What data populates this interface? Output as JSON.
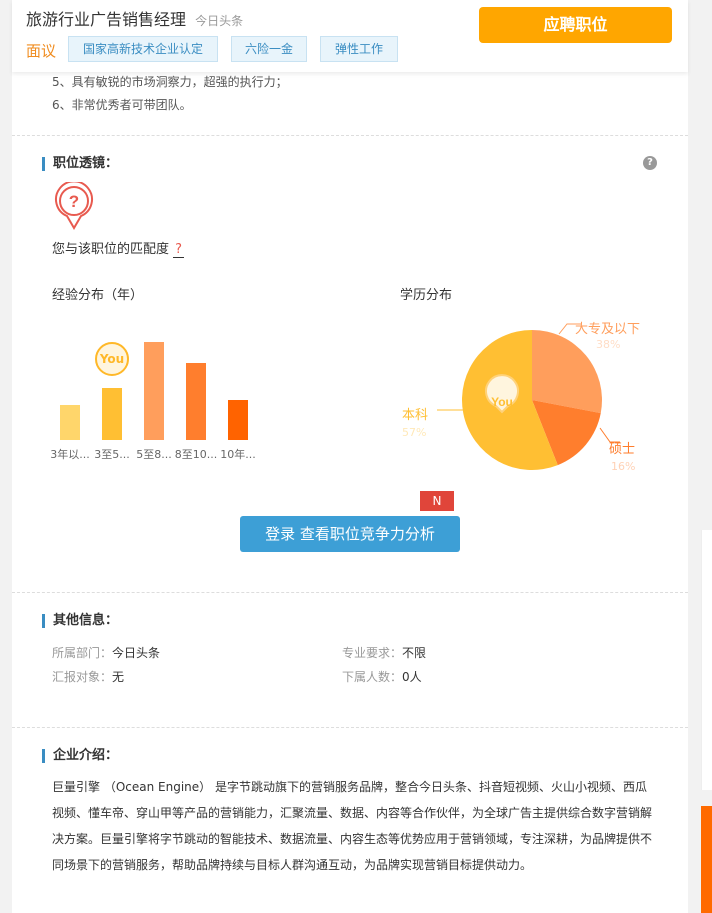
{
  "header": {
    "job_title": "旅游行业广告销售经理",
    "company_small": "今日头条",
    "apply_label": "应聘职位",
    "salary": "面议",
    "tags": [
      "国家高新技术企业认定",
      "六险一金",
      "弹性工作"
    ]
  },
  "requirements": [
    "5、具有敏锐的市场洞察力，超强的执行力；",
    "6、非常优秀者可带团队。"
  ],
  "lens": {
    "title": "职位透镜：",
    "help": "?",
    "match_label": "您与该职位的匹配度",
    "match_value": "?"
  },
  "chart_data": [
    {
      "type": "bar",
      "title": "经验分布（年）",
      "categories": [
        "3年以...",
        "3至5...",
        "5至8...",
        "8至10...",
        "10年..."
      ],
      "values": [
        0.36,
        0.53,
        1.0,
        0.79,
        0.41
      ],
      "colors": [
        "#ffd66b",
        "#ffbf33",
        "#ff9e5c",
        "#ff7e2d",
        "#ff6300"
      ],
      "you_index": 1,
      "you_label": "You"
    },
    {
      "type": "pie",
      "title": "学历分布",
      "slices": [
        {
          "label": "大专及以下",
          "pct": "38%",
          "value": 28,
          "color": "#ff9e5c"
        },
        {
          "label": "硕士",
          "pct": "16%",
          "value": 16,
          "color": "#ff7e2d"
        },
        {
          "label": "本科",
          "pct": "57%",
          "value": 56,
          "color": "#ffbf33"
        }
      ],
      "you_label": "You"
    }
  ],
  "login": {
    "label": "登录 查看职位竞争力分析",
    "badge": "N"
  },
  "other": {
    "title": "其他信息：",
    "dept_key": "所属部门：",
    "dept_val": "今日头条",
    "major_key": "专业要求：",
    "major_val": "不限",
    "report_key": "汇报对象：",
    "report_val": "无",
    "sub_key": "下属人数：",
    "sub_val": "0人"
  },
  "company": {
    "title": "企业介绍：",
    "intro": "巨量引擎 （Ocean Engine） 是字节跳动旗下的营销服务品牌，整合今日头条、抖音短视频、火山小视频、西瓜视频、懂车帝、穿山甲等产品的营销能力，汇聚流量、数据、内容等合作伙伴，为全球广告主提供综合数字营销解决方案。巨量引擎将字节跳动的智能技术、数据流量、内容生态等优势应用于营销领域，专注深耕，为品牌提供不同场景下的营销服务，帮助品牌持续与目标人群沟通互动，为品牌实现营销目标提供动力。"
  }
}
